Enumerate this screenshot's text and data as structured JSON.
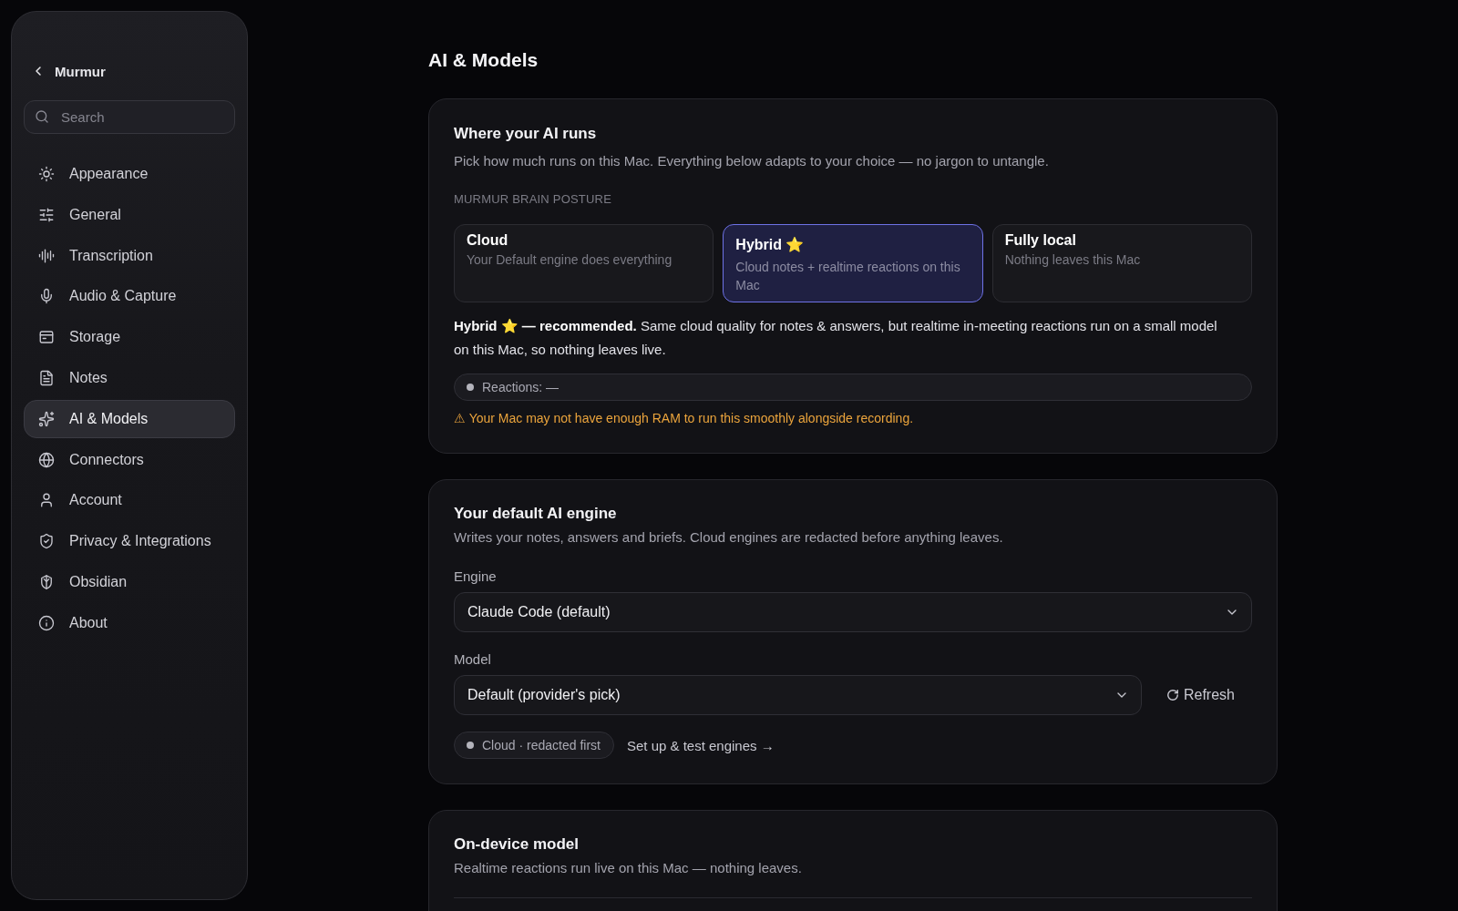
{
  "sidebar": {
    "back": {
      "label": "Murmur"
    },
    "search": {
      "placeholder": "Search"
    },
    "items": [
      {
        "label": "Appearance",
        "selected": false
      },
      {
        "label": "General",
        "selected": false
      },
      {
        "label": "Transcription",
        "selected": false
      },
      {
        "label": "Audio & Capture",
        "selected": false
      },
      {
        "label": "Storage",
        "selected": false
      },
      {
        "label": "Notes",
        "selected": false
      },
      {
        "label": "AI & Models",
        "selected": true
      },
      {
        "label": "Connectors",
        "selected": false
      },
      {
        "label": "Account",
        "selected": false
      },
      {
        "label": "Privacy & Integrations",
        "selected": false
      },
      {
        "label": "Obsidian",
        "selected": false
      },
      {
        "label": "About",
        "selected": false
      }
    ]
  },
  "page": {
    "title": "AI & Models"
  },
  "where_ai_runs": {
    "title": "Where your AI runs",
    "description": "Pick how much runs on this Mac. Everything below adapts to your choice — no jargon to untangle.",
    "section_label": "MURMUR BRAIN POSTURE",
    "options": [
      {
        "title": "Cloud",
        "subtitle": "Your Default engine does everything",
        "selected": false
      },
      {
        "title": "Hybrid ⭐",
        "subtitle": "Cloud notes + realtime reactions on this Mac",
        "selected": true
      },
      {
        "title": "Fully local",
        "subtitle": "Nothing leaves this Mac",
        "selected": false
      }
    ],
    "explanation": "**Hybrid ⭐ — recommended.** Same cloud quality for notes & answers, but realtime in-meeting reactions run on a small model on this Mac, so nothing leaves live.",
    "status": {
      "label": "Reactions: —"
    },
    "warning": "⚠ Your Mac may not have enough RAM to run this smoothly alongside recording."
  },
  "default_engine": {
    "title": "Your default AI engine",
    "description": "Writes your notes, answers and briefs. Cloud engines are redacted before anything leaves.",
    "engine": {
      "label": "Engine",
      "value": "Claude Code (default)"
    },
    "model": {
      "label": "Model",
      "value": "Default (provider's pick)"
    },
    "refresh_button": "Refresh",
    "status": {
      "label": "Cloud · redacted first"
    },
    "link": "Set up & test engines →"
  },
  "on_device_model": {
    "title": "On-device model",
    "description": "Realtime reactions run live on this Mac — nothing leaves."
  }
}
